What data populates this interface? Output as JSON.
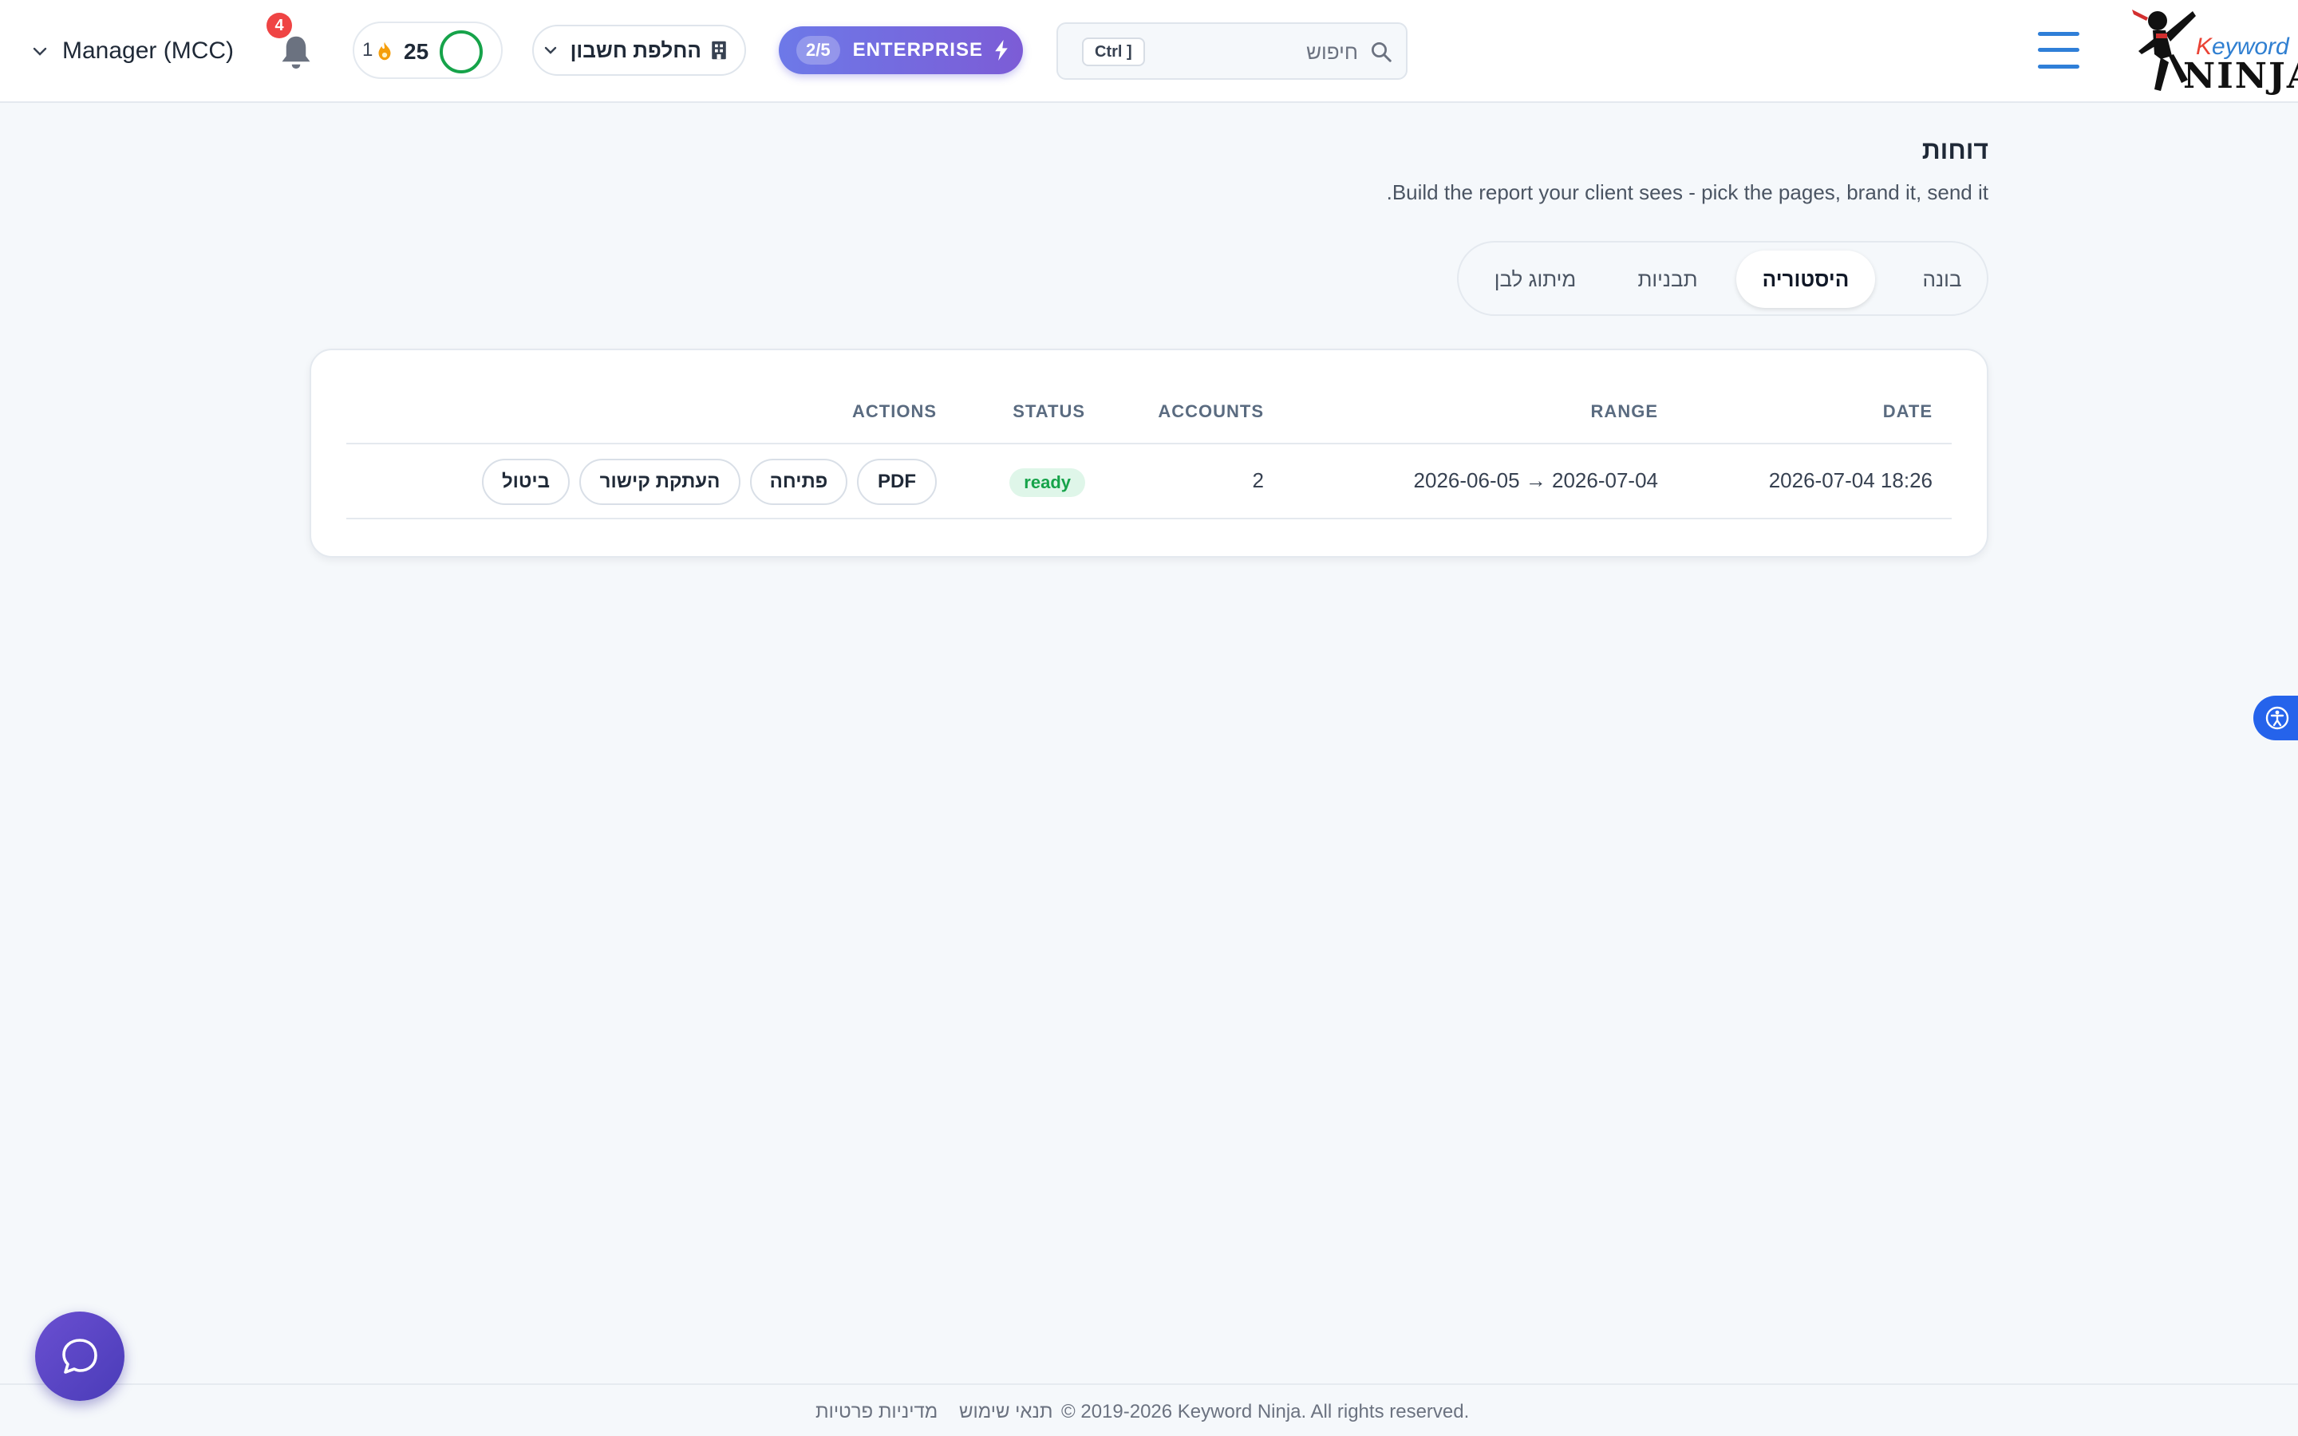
{
  "header": {
    "logo": {
      "line1_k": "K",
      "line1_rest": "eyword",
      "line2": "NINJA"
    },
    "search": {
      "placeholder": "חיפוש",
      "shortcut": "Ctrl ]"
    },
    "plan": {
      "count": "2/5",
      "name": "ENTERPRISE"
    },
    "account_switch": {
      "label": "החלפת חשבון"
    },
    "credits": {
      "streak": "1",
      "value": "25"
    },
    "notifications": {
      "count": "4"
    },
    "user": {
      "name": "Manager (MCC)"
    }
  },
  "page": {
    "title": "דוחות",
    "subtitle": "Build the report your client sees - pick the pages, brand it, send it."
  },
  "tabs": [
    {
      "label": "בונה",
      "active": false
    },
    {
      "label": "היסטוריה",
      "active": true
    },
    {
      "label": "תבניות",
      "active": false
    },
    {
      "label": "מיתוג לבן",
      "active": false
    }
  ],
  "history_table": {
    "columns": {
      "date": "DATE",
      "range": "RANGE",
      "accounts": "ACCOUNTS",
      "status": "STATUS",
      "actions": "ACTIONS"
    },
    "rows": [
      {
        "date": "2026-07-04 18:26",
        "range": "2026-06-05 → 2026-07-04",
        "accounts": "2",
        "status": "ready",
        "actions": {
          "pdf": "PDF",
          "open": "פתיחה",
          "copy_link": "העתקת קישור",
          "cancel": "ביטול"
        }
      }
    ]
  },
  "footer": {
    "copyright": "© 2019-2026 Keyword Ninja. All rights reserved.",
    "terms": "תנאי שימוש",
    "privacy": "מדיניות פרטיות"
  },
  "colors": {
    "accent": "#2f7fd8",
    "plan_gradient_start": "#6d79e8",
    "plan_gradient_end": "#7c5cd6",
    "status_ready_bg": "#dff6e9",
    "status_ready_text": "#16a34a",
    "notification_badge": "#ef4444",
    "accessibility": "#2563eb",
    "chat": "#5a45c6"
  },
  "icons": {
    "menu": "hamburger-icon",
    "search": "search-icon",
    "plan": "bolt-icon",
    "account_switch": "building-icon",
    "credits": "fire-icon",
    "notifications": "bell-icon",
    "user_menu": "chevron-down-icon",
    "accessibility": "accessibility-icon",
    "chat": "chat-bubble-icon"
  }
}
